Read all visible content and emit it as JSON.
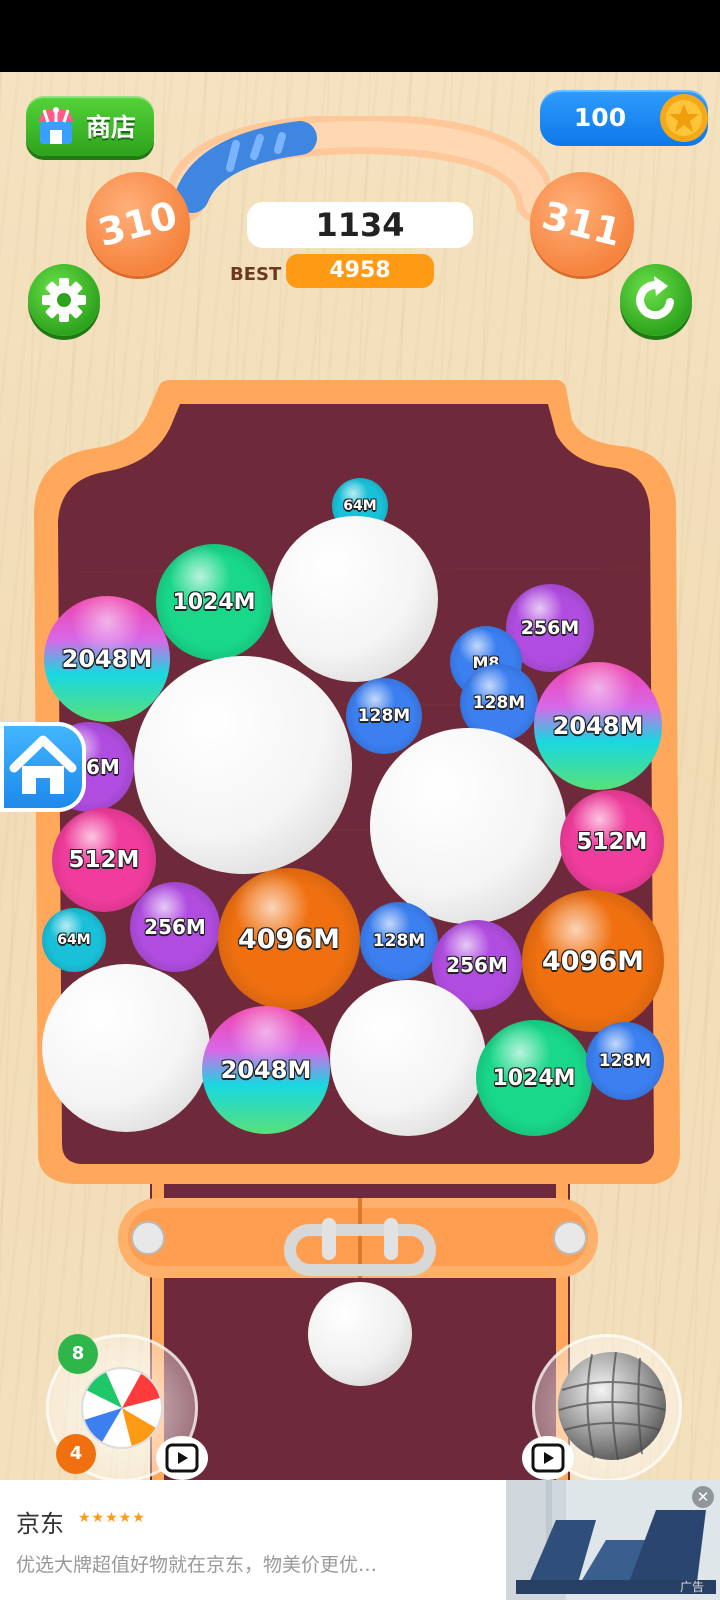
{
  "header": {
    "shop_label": "商店",
    "coins": "100",
    "level_current": "310",
    "level_next": "311",
    "level_progress": 0.25,
    "score": "1134",
    "best_label": "BEST",
    "best_score": "4958"
  },
  "queue_ball": {
    "label": "64M",
    "color": "#19c0d8"
  },
  "balls": [
    {
      "label": "1024M",
      "color": "#19d88a",
      "size": 116
    },
    {
      "label": "",
      "color": "#ffffff",
      "size": 166
    },
    {
      "label": "2048M",
      "color": "rainbow",
      "size": 126
    },
    {
      "label": "256M",
      "color": "#b04de0",
      "size": 88
    },
    {
      "label": "M8",
      "color": "#3b7ff0",
      "size": 72
    },
    {
      "label": "128M",
      "color": "#3b7ff0",
      "size": 78
    },
    {
      "label": "",
      "color": "#ffffff",
      "size": 218
    },
    {
      "label": "128M",
      "color": "#3b7ff0",
      "size": 76
    },
    {
      "label": "2048M",
      "color": "rainbow",
      "size": 128
    },
    {
      "label": "256M",
      "color": "#b04de0",
      "size": 90
    },
    {
      "label": "",
      "color": "#ffffff",
      "size": 196
    },
    {
      "label": "512M",
      "color": "#f03c9c",
      "size": 104
    },
    {
      "label": "512M",
      "color": "#f03c9c",
      "size": 104
    },
    {
      "label": "256M",
      "color": "#b04de0",
      "size": 90
    },
    {
      "label": "4096M",
      "color": "#f07010",
      "size": 142
    },
    {
      "label": "128M",
      "color": "#3b7ff0",
      "size": 78
    },
    {
      "label": "256M",
      "color": "#b04de0",
      "size": 90
    },
    {
      "label": "4096M",
      "color": "#f07010",
      "size": 142
    },
    {
      "label": "64M",
      "color": "#19c0d8",
      "size": 64
    },
    {
      "label": "",
      "color": "#ffffff",
      "size": 168
    },
    {
      "label": "2048M",
      "color": "rainbow",
      "size": 128
    },
    {
      "label": "",
      "color": "#ffffff",
      "size": 156
    },
    {
      "label": "1024M",
      "color": "#19d88a",
      "size": 116
    },
    {
      "label": "128M",
      "color": "#3b7ff0",
      "size": 78
    }
  ],
  "launcher_ball": {
    "color": "#ffffff"
  },
  "powerups": {
    "beach_ball_count_top": "8",
    "beach_ball_count_bottom": "4"
  },
  "ad": {
    "title": "京东",
    "stars": "★★★★★",
    "description": "优选大牌超值好物就在京东，物美价更优…",
    "close": "✕",
    "tag": "广告"
  },
  "colors": {
    "board_frame": "#ffa75a",
    "board_inner": "#6e2a3a",
    "coin_bg": "#1f8cf5",
    "best_bg": "#ff9a14"
  }
}
